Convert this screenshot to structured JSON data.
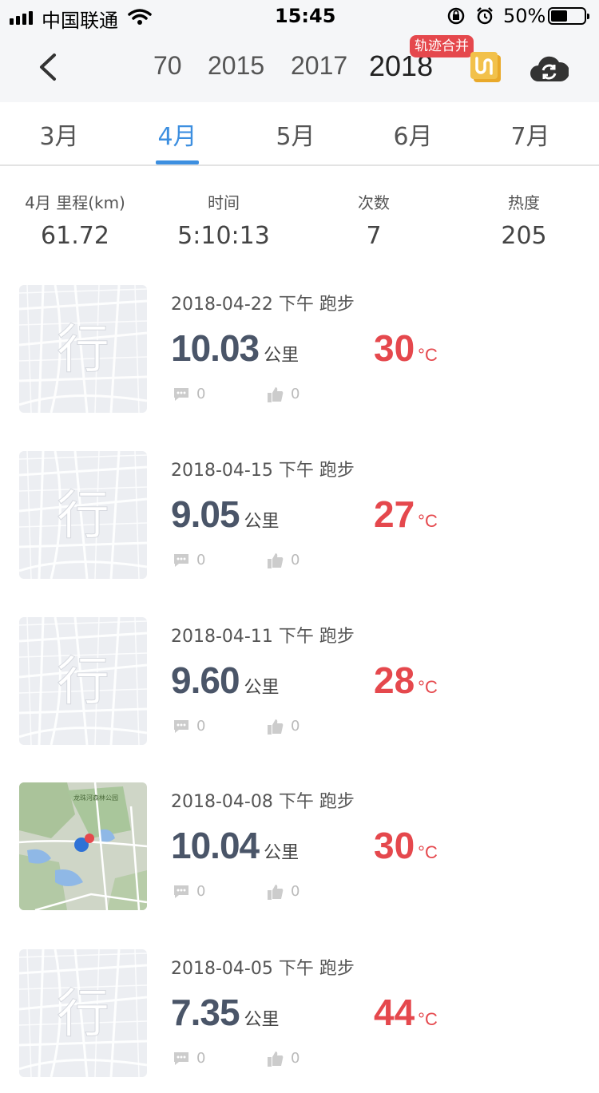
{
  "status_bar": {
    "carrier": "中国联通",
    "time": "15:45",
    "battery": "50%",
    "battery_level": 0.5
  },
  "year_nav": {
    "years": [
      "70",
      "2015",
      "2017",
      "2018"
    ],
    "active_year": "2018",
    "merge_badge": "轨迹合并"
  },
  "month_tabs": {
    "items": [
      "3月",
      "4月",
      "5月",
      "6月",
      "7月"
    ],
    "active": "4月"
  },
  "stats": {
    "mileage_label": "4月 里程(km)",
    "mileage": "61.72",
    "time_label": "时间",
    "time": "5:10:13",
    "count_label": "次数",
    "count": "7",
    "heat_label": "热度",
    "heat": "205"
  },
  "runs": [
    {
      "date": "2018-04-22 下午  跑步",
      "distance": "10.03",
      "unit": "公里",
      "temp": "30",
      "temp_unit": "°C",
      "comments": "0",
      "likes": "0",
      "thumb": "placeholder"
    },
    {
      "date": "2018-04-15 下午  跑步",
      "distance": "9.05",
      "unit": "公里",
      "temp": "27",
      "temp_unit": "°C",
      "comments": "0",
      "likes": "0",
      "thumb": "placeholder"
    },
    {
      "date": "2018-04-11 下午  跑步",
      "distance": "9.60",
      "unit": "公里",
      "temp": "28",
      "temp_unit": "°C",
      "comments": "0",
      "likes": "0",
      "thumb": "placeholder"
    },
    {
      "date": "2018-04-08 下午  跑步",
      "distance": "10.04",
      "unit": "公里",
      "temp": "30",
      "temp_unit": "°C",
      "comments": "0",
      "likes": "0",
      "thumb": "map",
      "map_label": "龙珠河森林公园"
    },
    {
      "date": "2018-04-05 下午  跑步",
      "distance": "7.35",
      "unit": "公里",
      "temp": "44",
      "temp_unit": "°C",
      "comments": "0",
      "likes": "0",
      "thumb": "placeholder"
    }
  ],
  "placeholder_char": "行",
  "colors": {
    "accent": "#3d8fe0",
    "temp": "#e5484d",
    "badge": "#e5484d",
    "merge_icon": "#f2b632"
  }
}
